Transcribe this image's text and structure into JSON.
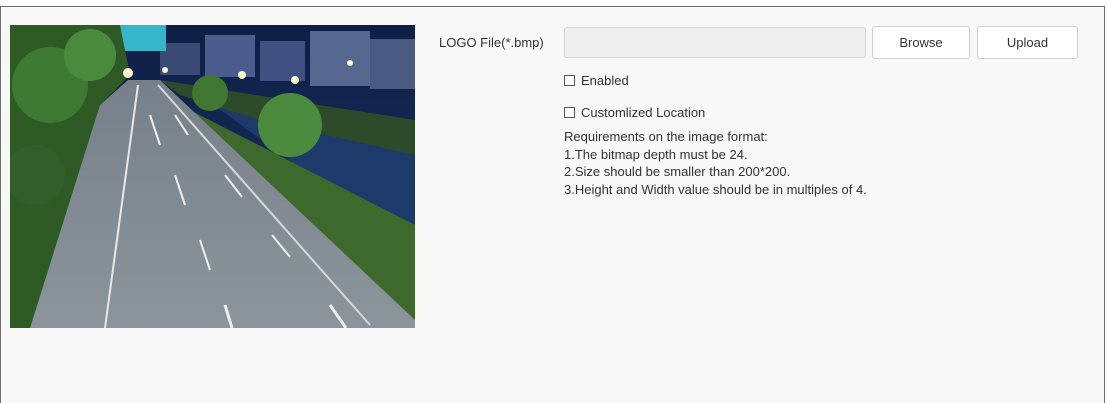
{
  "logo": {
    "label": "LOGO File(*.bmp)",
    "file_value": "",
    "browse_label": "Browse",
    "upload_label": "Upload"
  },
  "options": {
    "enabled_label": "Enabled",
    "enabled_checked": false,
    "custom_location_label": "Customlized Location",
    "custom_location_checked": false
  },
  "requirements": {
    "title": "Requirements on the image format:",
    "items": [
      "1.The bitmap depth must be 24.",
      "2.Size should be smaller than 200*200.",
      "3.Height and Width value should be in multiples of 4."
    ]
  }
}
